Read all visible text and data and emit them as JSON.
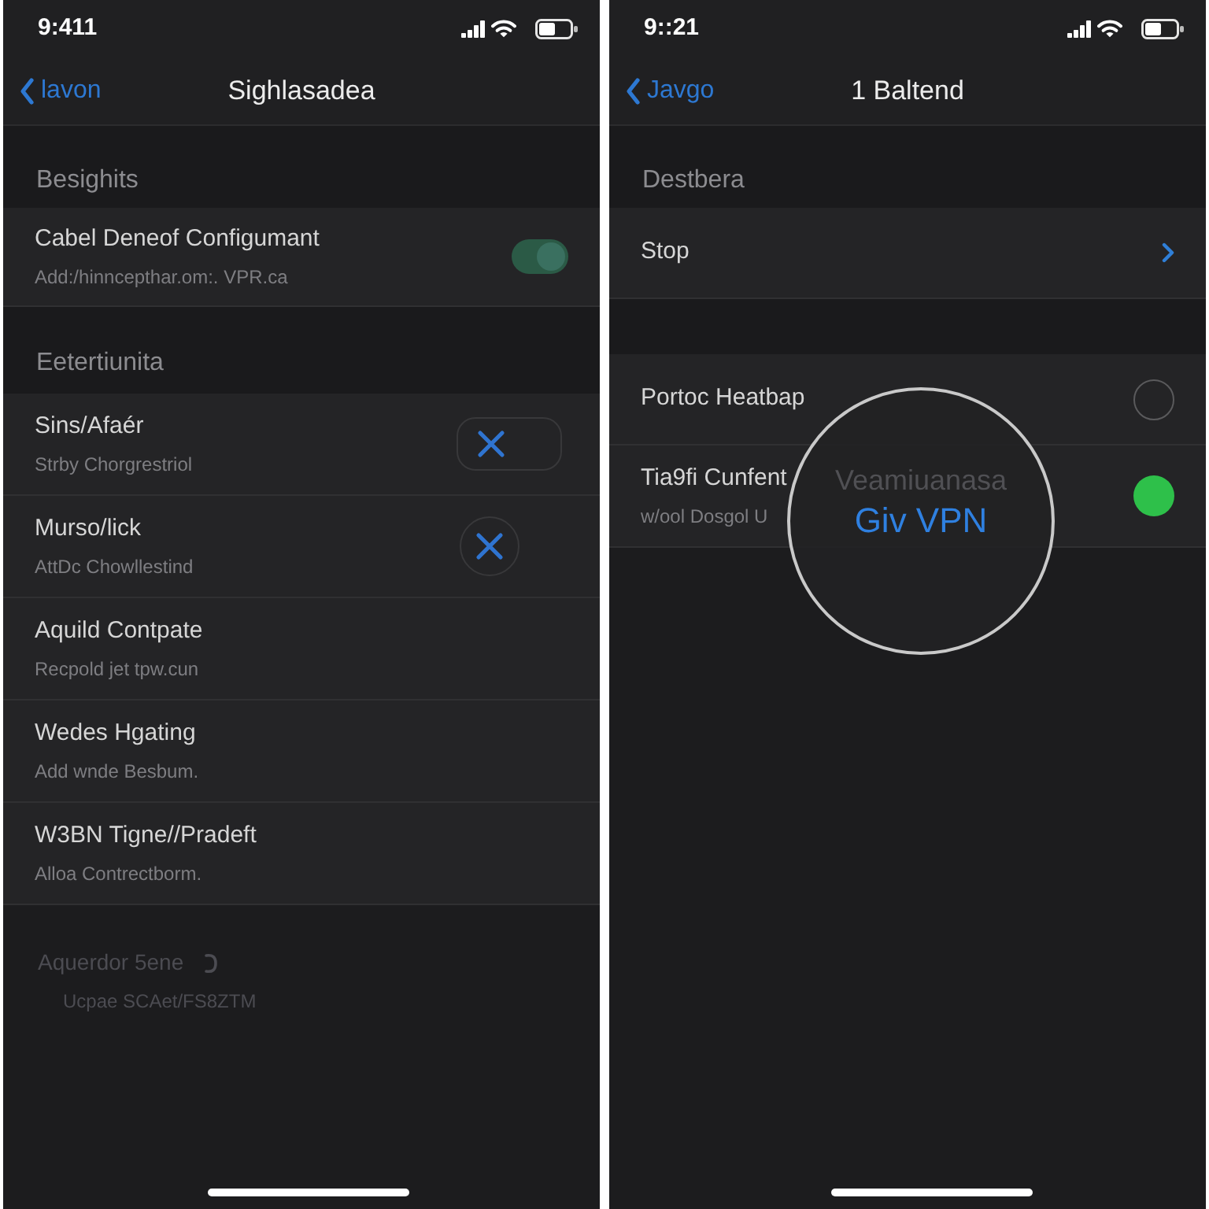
{
  "screens": [
    {
      "status_bar": {
        "time": "9:411"
      },
      "nav": {
        "back": "lavon",
        "title": "Sighlasadea"
      },
      "sections": [
        {
          "header": "Besighits",
          "rows": [
            {
              "kind": "toggle",
              "title": "Cabel Deneof Configumant",
              "subtitle": "Add:/hinncepthar.om:. VPR.ca",
              "on": true
            }
          ]
        },
        {
          "header": "Eetertiunita",
          "rows": [
            {
              "kind": "pillx",
              "title": "Sins/Afaér",
              "subtitle": "Strby Chorgrestriol"
            },
            {
              "kind": "roundx",
              "title": "Murso/lick",
              "subtitle": "AttDc Chowllestind"
            },
            {
              "kind": "plain",
              "title": "Aquild Contpate",
              "subtitle": "Recpold jet tpw.cun"
            },
            {
              "kind": "plain",
              "title": "Wedes Hgating",
              "subtitle": "Add wnde Besbum."
            },
            {
              "kind": "plain",
              "title": "W3BN Tigne//Pradeft",
              "subtitle": "Alloa Contrectborm."
            }
          ]
        }
      ],
      "footer": {
        "title": "Aquerdor 5ene",
        "subtitle": "Ucpae SCAet/FS8ZTM"
      }
    },
    {
      "status_bar": {
        "time": "9::21"
      },
      "nav": {
        "back": "Javgo",
        "title": "1 Baltend"
      },
      "sections": [
        {
          "header": "Destbera",
          "rows": [
            {
              "kind": "link",
              "title": "Stop"
            }
          ]
        },
        {
          "rows": [
            {
              "kind": "radio",
              "title": "Portoc Heatbap",
              "selected": false
            },
            {
              "kind": "radio",
              "title": "Tia9fi Cunfent",
              "subtitle": "w/ool Dosgol U",
              "selected": true
            }
          ]
        }
      ],
      "lens": {
        "faint_text": "Veamiuanasa",
        "label": "Giv VPN"
      }
    }
  ]
}
